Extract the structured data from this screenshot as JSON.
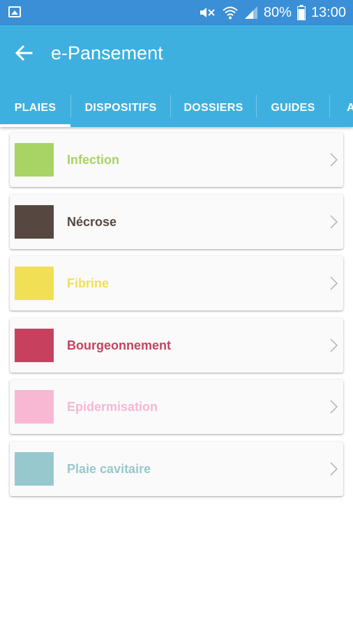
{
  "status_bar": {
    "battery": "80%",
    "time": "13:00",
    "icons": [
      "gallery-icon",
      "mute-icon",
      "wifi-icon",
      "signal-icon",
      "battery-icon"
    ]
  },
  "app_bar": {
    "title": "e-Pansement",
    "background": "#3eb0df",
    "back_icon": "arrow-back-icon"
  },
  "tabs": [
    {
      "label": "PLAIES",
      "selected": true
    },
    {
      "label": "DISPOSITIFS",
      "selected": false
    },
    {
      "label": "DOSSIERS",
      "selected": false
    },
    {
      "label": "GUIDES",
      "selected": false
    },
    {
      "label": "A",
      "selected": false
    }
  ],
  "items": [
    {
      "label": "Infection",
      "color": "#a8d465"
    },
    {
      "label": "Nécrose",
      "color": "#564840"
    },
    {
      "label": "Fibrine",
      "color": "#f1df55"
    },
    {
      "label": "Bourgeonnement",
      "color": "#c7415f"
    },
    {
      "label": "Epidermisation",
      "color": "#f8b7d2"
    },
    {
      "label": "Plaie cavitaire",
      "color": "#97c8ce"
    }
  ]
}
